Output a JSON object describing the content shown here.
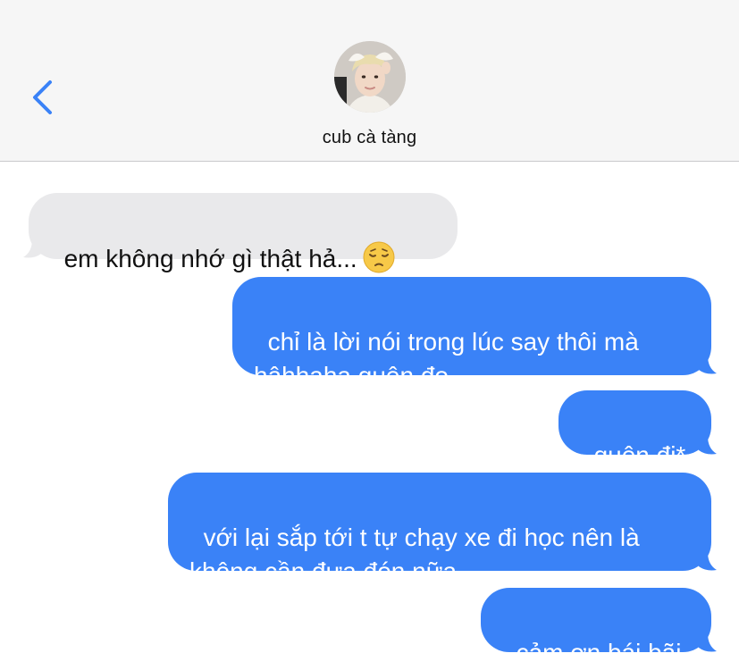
{
  "header": {
    "contact_name": "cub cà tàng"
  },
  "messages": [
    {
      "direction": "incoming",
      "text": "em không nhớ gì thật hả...",
      "emoji": "pensive-face"
    },
    {
      "direction": "outgoing",
      "text": "chỉ là lời nói trong lúc say thôi mà\nhâhhaha quên đo"
    },
    {
      "direction": "outgoing",
      "text": "quên đi*"
    },
    {
      "direction": "outgoing",
      "text": "với lại sắp tới t tự chạy xe đi học nên là\nkhông cần đưa đón nữa"
    },
    {
      "direction": "outgoing",
      "text": "cảm ơn bái bãi"
    }
  ],
  "colors": {
    "outgoing_bubble": "#3a82f7",
    "incoming_bubble": "#e9e9eb",
    "back_chevron": "#3a82f7",
    "header_background": "#f6f6f6"
  },
  "icons": {
    "back": "chevron-left-icon",
    "avatar": "contact-avatar"
  }
}
